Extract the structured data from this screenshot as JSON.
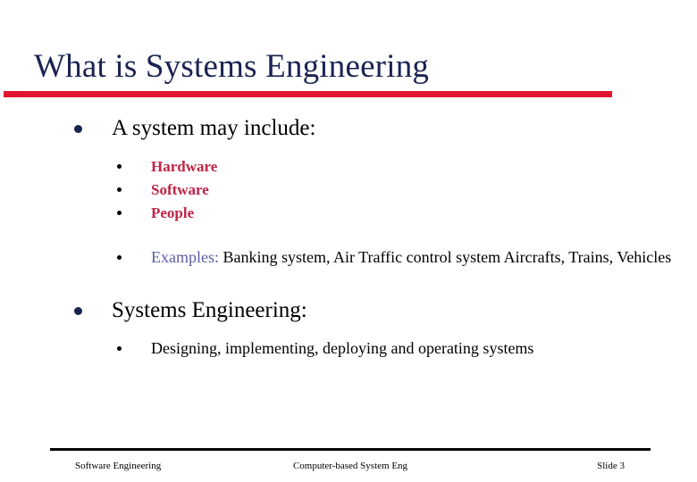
{
  "slide": {
    "title": "What is Systems Engineering",
    "accent_rule_color": "#e2142f",
    "title_color": "#1a2352",
    "bullets": [
      {
        "level": 1,
        "text": "A system may include:"
      },
      {
        "level": 2,
        "text": "Hardware",
        "color": "#bf2347"
      },
      {
        "level": 2,
        "text": "Software",
        "color": "#bf2347"
      },
      {
        "level": 2,
        "text": "People",
        "color": "#bf2347"
      },
      {
        "level": 2,
        "label": "Examples:",
        "label_color": "#5d5da8",
        "text": " Banking system, Air Traffic control system Aircrafts, Trains, Vehicles"
      },
      {
        "level": 1,
        "text": "Systems Engineering:"
      },
      {
        "level": 2,
        "text": "Designing, implementing, deploying and operating systems"
      }
    ],
    "footer": {
      "left": "Software Engineering",
      "center": "Computer-based System Eng",
      "right": "Slide  3"
    }
  }
}
